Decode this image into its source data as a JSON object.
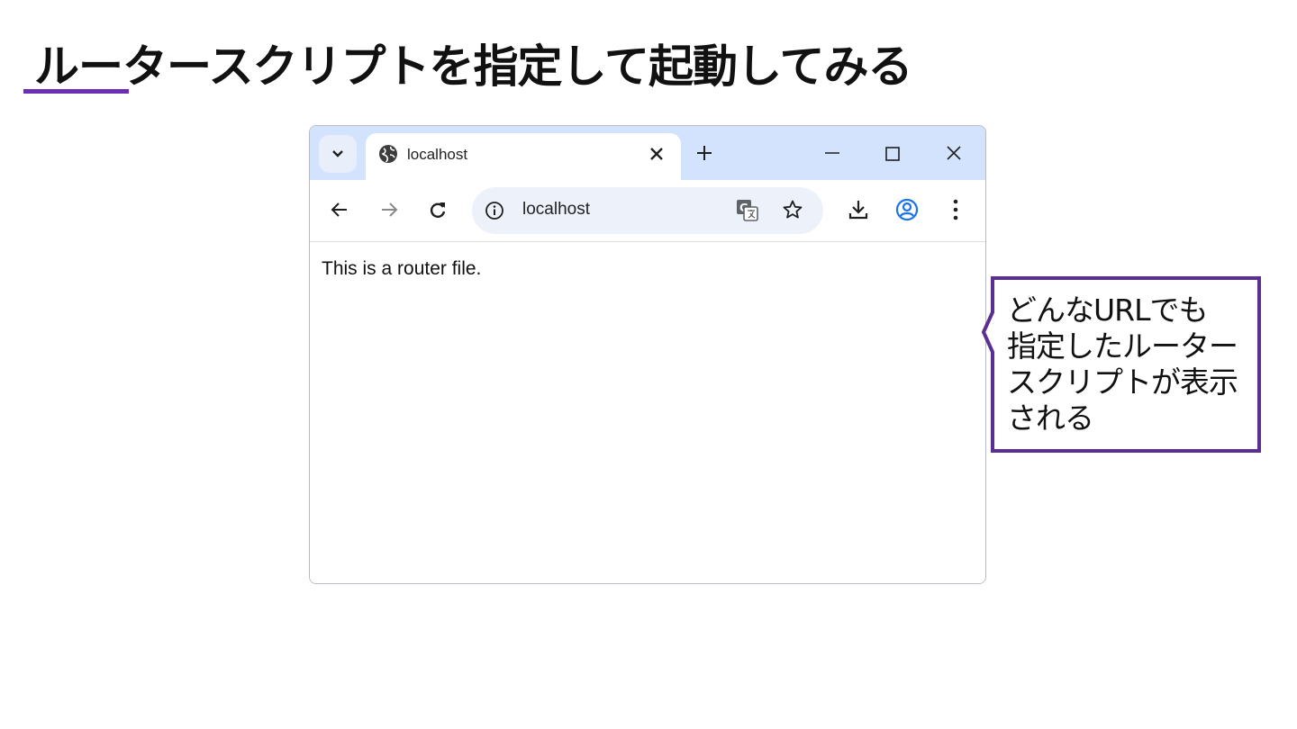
{
  "slide": {
    "title": "ルータースクリプトを指定して起動してみる",
    "accent_color": "#6a2fb5"
  },
  "browser": {
    "tab": {
      "title": "localhost",
      "icon": "globe-icon"
    },
    "window_controls": {
      "minimize_icon": "minimize-icon",
      "maximize_icon": "maximize-icon",
      "close_icon": "close-icon"
    },
    "toolbar": {
      "back_icon": "arrow-left-icon",
      "forward_icon": "arrow-right-icon",
      "reload_icon": "reload-icon",
      "address": "localhost",
      "site_info_icon": "info-icon",
      "translate_icon": "translate-icon",
      "bookmark_icon": "star-icon",
      "download_icon": "download-icon",
      "profile_icon": "profile-icon",
      "menu_icon": "kebab-menu-icon"
    },
    "content": {
      "text": "This is a router file."
    },
    "colors": {
      "tabstrip": "#d3e3fd",
      "omnibox": "#edf2fa",
      "profile": "#1a73e8"
    }
  },
  "callout": {
    "lines": [
      "どんなURLでも",
      "指定したルーター",
      "スクリプトが表示",
      "される"
    ]
  }
}
